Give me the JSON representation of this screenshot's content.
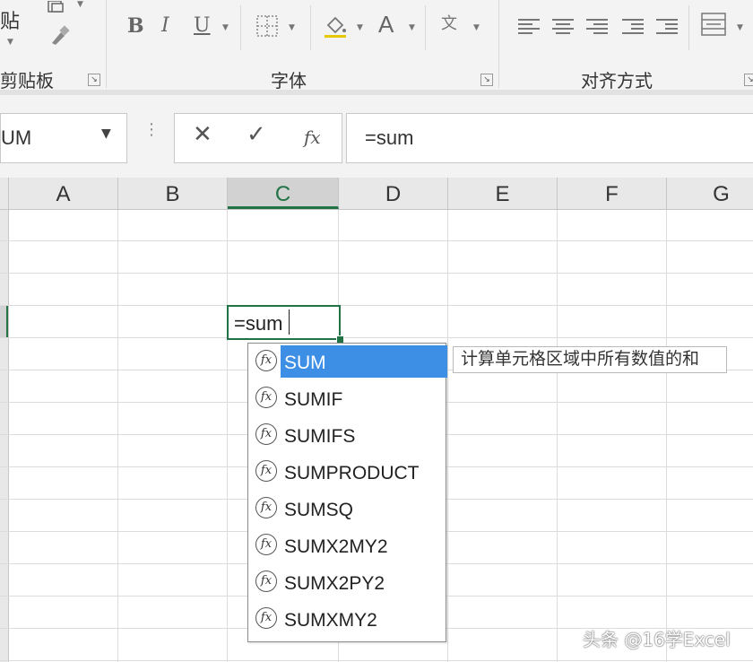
{
  "ribbon": {
    "clipboard": {
      "paste_label": "贴",
      "group_label": "剪贴板"
    },
    "font": {
      "group_label": "字体",
      "bold": "B",
      "italic": "I",
      "underline": "U",
      "font_color_glyph": "A"
    },
    "alignment": {
      "group_label": "对齐方式"
    }
  },
  "formula_bar": {
    "name_box": "UM",
    "cancel_glyph": "✕",
    "enter_glyph": "✓",
    "function_glyph": "fx",
    "formula_text": "=sum"
  },
  "grid": {
    "columns": [
      "A",
      "B",
      "C",
      "D",
      "E",
      "F",
      "G"
    ],
    "active_column": "C",
    "active_cell_text": "=sum"
  },
  "autocomplete": {
    "items": [
      {
        "label": "SUM",
        "selected": true
      },
      {
        "label": "SUMIF",
        "selected": false
      },
      {
        "label": "SUMIFS",
        "selected": false
      },
      {
        "label": "SUMPRODUCT",
        "selected": false
      },
      {
        "label": "SUMSQ",
        "selected": false
      },
      {
        "label": "SUMX2MY2",
        "selected": false
      },
      {
        "label": "SUMX2PY2",
        "selected": false
      },
      {
        "label": "SUMXMY2",
        "selected": false
      }
    ],
    "icon_glyph": "fx",
    "tooltip": "计算单元格区域中所有数值的和"
  },
  "watermark": "头条 @16学Excel",
  "colors": {
    "accent_green": "#217346",
    "selection_blue": "#3d8fe6"
  }
}
